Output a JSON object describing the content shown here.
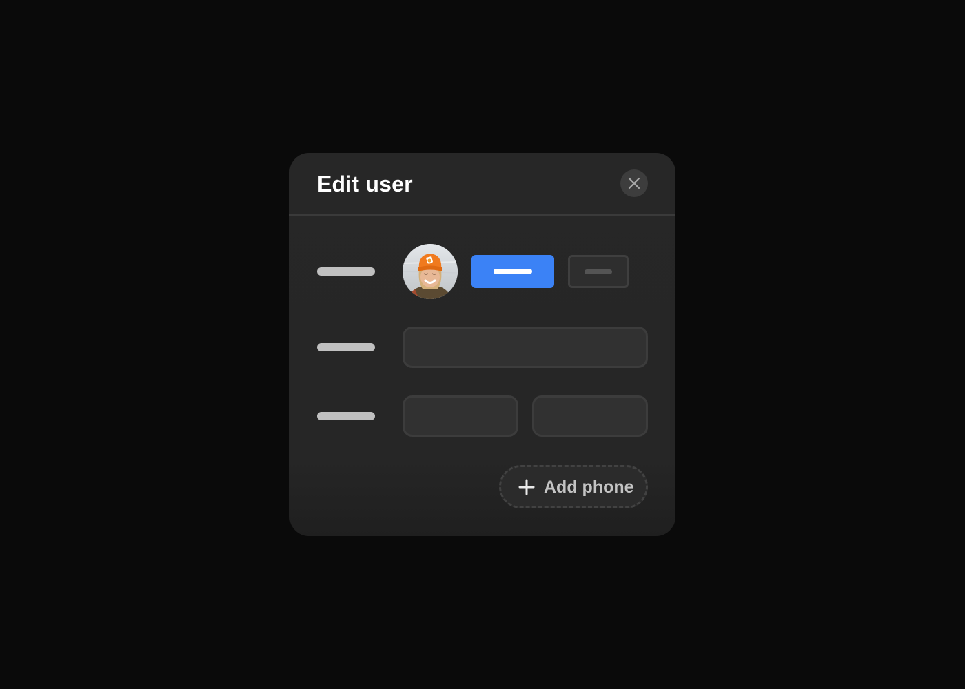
{
  "modal": {
    "title": "Edit user",
    "close_icon": "close-icon",
    "rows": [
      {
        "label": "",
        "type": "avatar-row",
        "avatar": {
          "description": "User avatar: smiling person wearing orange beanie",
          "icon": "avatar-photo"
        },
        "primary_button": {
          "label": "",
          "color": "#3b82f6"
        },
        "secondary_button": {
          "label": ""
        }
      },
      {
        "label": "",
        "type": "single-input",
        "inputs": [
          {
            "value": "",
            "placeholder": ""
          }
        ]
      },
      {
        "label": "",
        "type": "double-input",
        "inputs": [
          {
            "value": "",
            "placeholder": ""
          },
          {
            "value": "",
            "placeholder": ""
          }
        ]
      }
    ],
    "add_phone": {
      "label": "Add phone",
      "icon": "plus-icon"
    }
  },
  "colors": {
    "background": "#0a0a0a",
    "modal": "#272727",
    "accent": "#3b82f6",
    "placeholder_bar": "#c0c0c0"
  }
}
